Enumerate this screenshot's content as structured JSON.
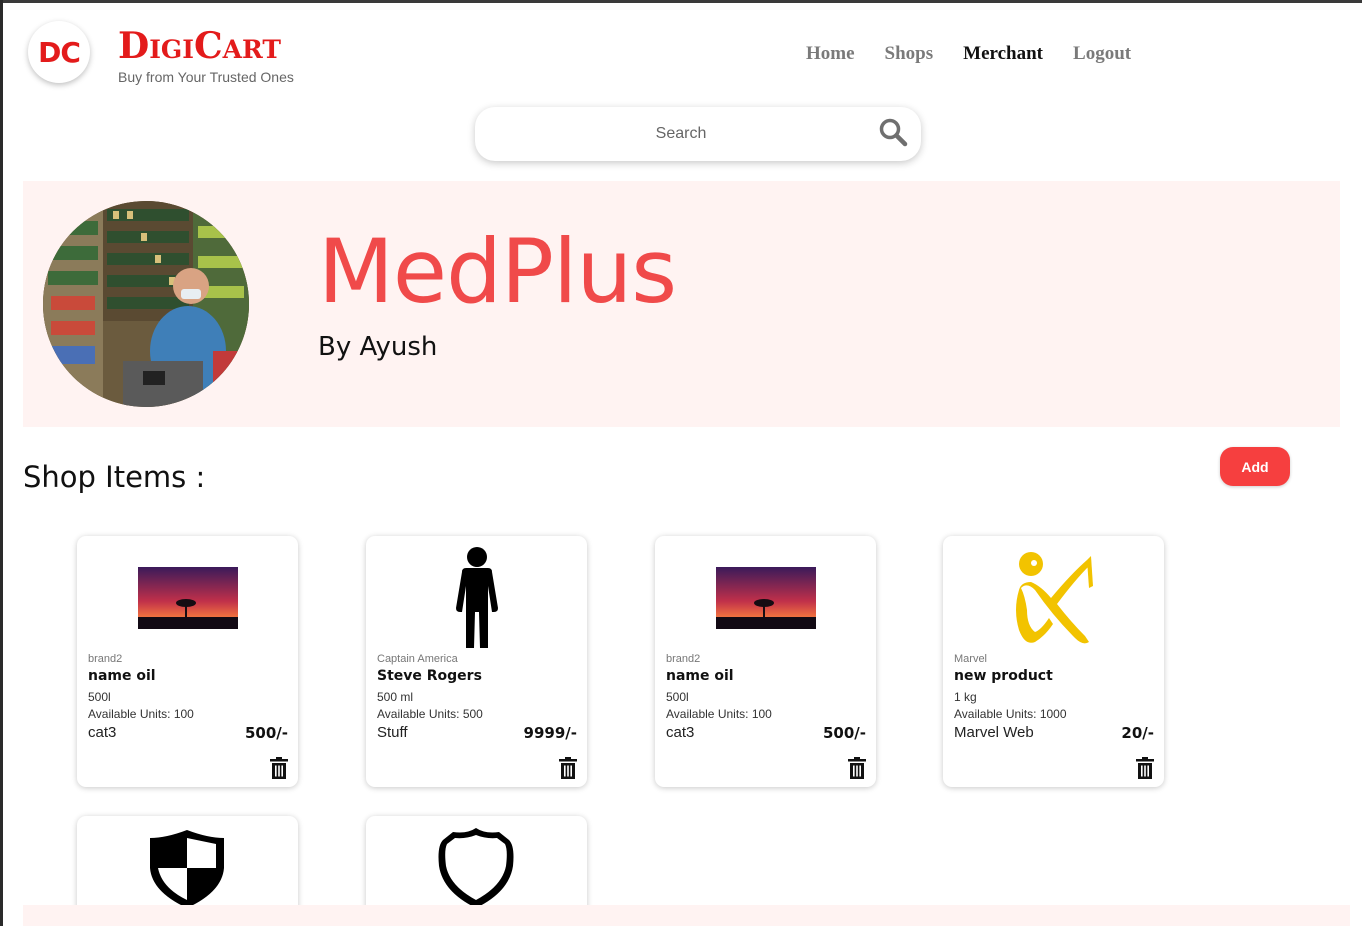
{
  "header": {
    "logo_initials": "DC",
    "brand_name": "DigiCart",
    "tagline": "Buy from Your Trusted Ones",
    "nav": [
      {
        "label": "Home",
        "active": false
      },
      {
        "label": "Shops",
        "active": false
      },
      {
        "label": "Merchant",
        "active": true
      },
      {
        "label": "Logout",
        "active": false
      }
    ]
  },
  "search": {
    "placeholder": "Search",
    "icon": "search-icon"
  },
  "shop": {
    "name": "MedPlus",
    "owner": "By Ayush"
  },
  "items_section": {
    "title": "Shop Items :",
    "add_label": "Add"
  },
  "items": [
    {
      "brand": "brand2",
      "name": "name oil",
      "quantity": "500l",
      "units": "Available Units: 100",
      "category": "cat3",
      "price": "500/-",
      "image": "sunset-tree-image"
    },
    {
      "brand": "Captain America",
      "name": "Steve Rogers",
      "quantity": "500 ml",
      "units": "Available Units: 500",
      "category": "Stuff",
      "price": "9999/-",
      "image": "person-silhouette-icon"
    },
    {
      "brand": "brand2",
      "name": "name oil",
      "quantity": "500l",
      "units": "Available Units: 100",
      "category": "cat3",
      "price": "500/-",
      "image": "sunset-tree-image"
    },
    {
      "brand": "Marvel",
      "name": "new product",
      "quantity": "1 kg",
      "units": "Available Units: 1000",
      "category": "Marvel Web",
      "price": "20/-",
      "image": "yellow-figure-logo"
    }
  ],
  "partial_items": [
    {
      "image": "shield-checker-icon"
    },
    {
      "image": "shield-outline-icon"
    }
  ],
  "colors": {
    "brand_red": "#e31b1b",
    "shop_title": "#f04a4a",
    "banner_bg": "#fff3f2",
    "add_button": "#f63f3f"
  }
}
